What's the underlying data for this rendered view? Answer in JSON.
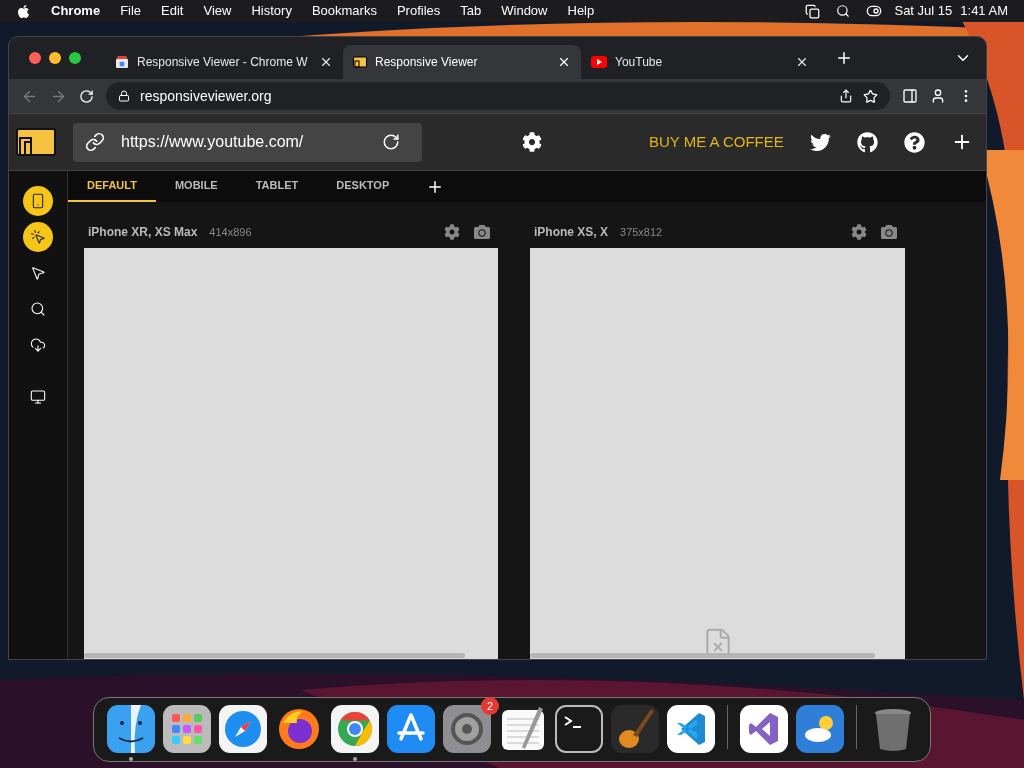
{
  "menu_bar": {
    "app": "Chrome",
    "menus": [
      "File",
      "Edit",
      "View",
      "History",
      "Bookmarks",
      "Profiles",
      "Tab",
      "Window",
      "Help"
    ],
    "date": "Sat Jul 15",
    "time": "1:41 AM"
  },
  "browser": {
    "tabs": [
      {
        "title": "Responsive Viewer - Chrome W",
        "kind": "store",
        "selected": false
      },
      {
        "title": "Responsive Viewer",
        "kind": "viewer",
        "selected": true
      },
      {
        "title": "YouTube",
        "kind": "video",
        "selected": false
      }
    ],
    "address": "responsiveviewer.org"
  },
  "app": {
    "url": "https://www.youtube.com/",
    "coffee_label": "BUY ME A COFFEE",
    "view_tabs": [
      {
        "label": "DEFAULT",
        "selected": true
      },
      {
        "label": "MOBILE",
        "selected": false
      },
      {
        "label": "TABLET",
        "selected": false
      },
      {
        "label": "DESKTOP",
        "selected": false
      }
    ],
    "tools": [
      {
        "kind": "phone",
        "active": true
      },
      {
        "kind": "pointer-click",
        "active": true
      },
      {
        "kind": "pointer",
        "active": false
      },
      {
        "kind": "search",
        "active": false
      },
      {
        "kind": "download",
        "active": false
      },
      {
        "kind": "monitor",
        "active": false
      }
    ],
    "devices": [
      {
        "name": "iPhone XR, XS Max",
        "size": "414x896",
        "broken_page": false
      },
      {
        "name": "iPhone XS, X",
        "size": "375x812",
        "broken_page": true
      }
    ]
  },
  "dock": [
    {
      "kind": "finder",
      "running": true
    },
    {
      "kind": "launchpad",
      "running": false
    },
    {
      "kind": "safari",
      "running": false
    },
    {
      "kind": "firefox",
      "running": false
    },
    {
      "kind": "chrome",
      "running": true
    },
    {
      "kind": "appstore",
      "running": false
    },
    {
      "kind": "settings",
      "running": false,
      "badge": "2"
    },
    {
      "kind": "textedit",
      "running": false
    },
    {
      "kind": "terminal",
      "running": false
    },
    {
      "kind": "garageband",
      "running": false
    },
    {
      "kind": "vscode",
      "running": false
    },
    {
      "kind": "separator"
    },
    {
      "kind": "visualstudio",
      "running": false
    },
    {
      "kind": "weather",
      "running": false
    },
    {
      "kind": "separator"
    },
    {
      "kind": "trash",
      "running": false
    }
  ]
}
